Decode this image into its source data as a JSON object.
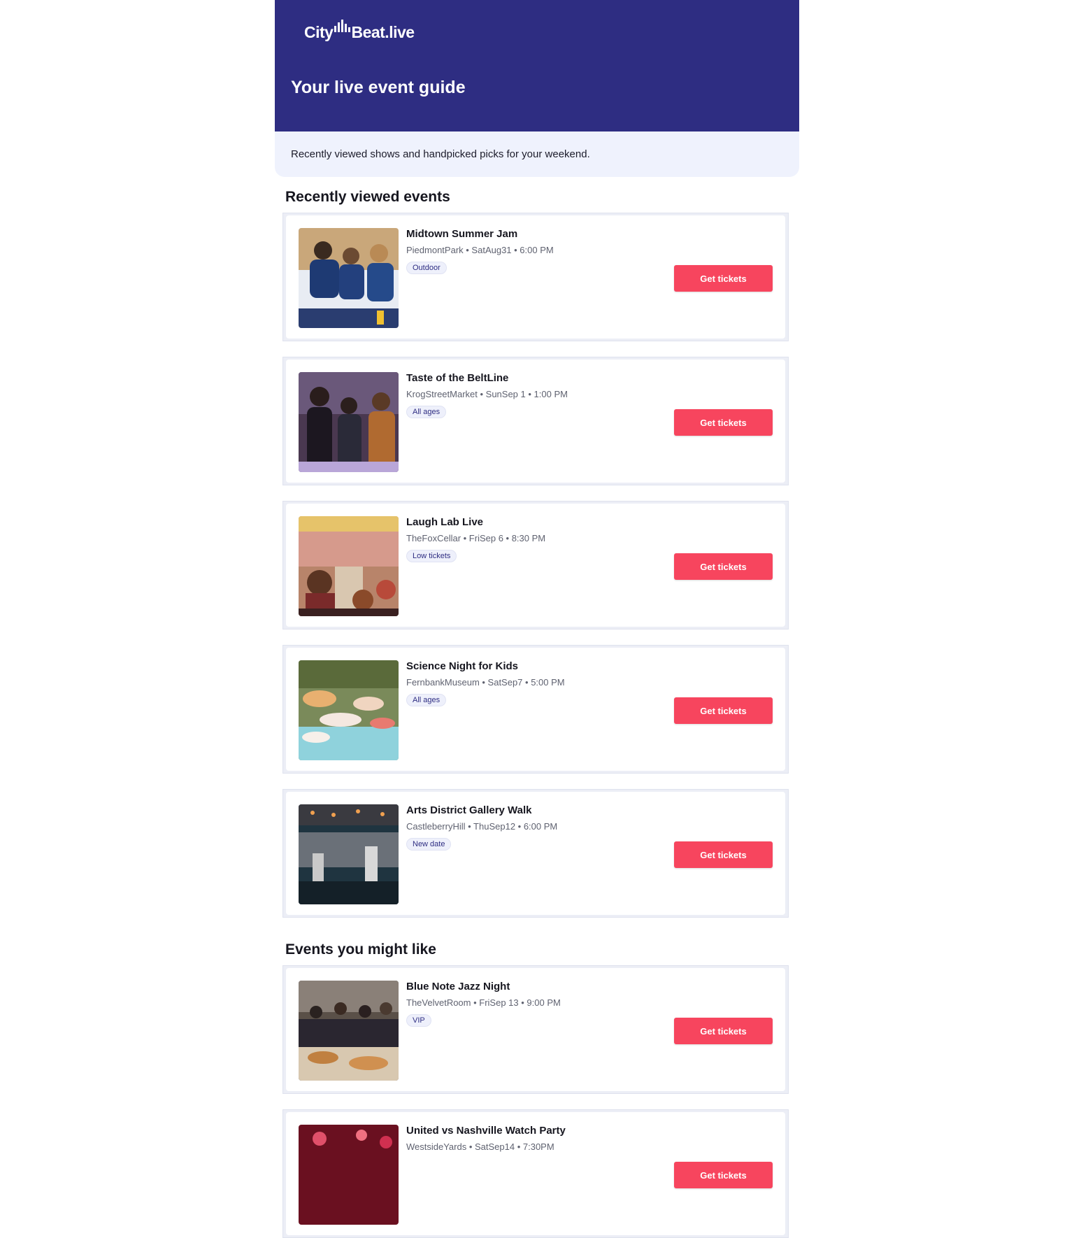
{
  "brand": {
    "logo_left": "City",
    "logo_right": "Beat.live"
  },
  "header": {
    "headline": "Your live event guide"
  },
  "intro": {
    "text": "Recently viewed shows and handpicked picks for your weekend."
  },
  "sections": [
    {
      "title": "Recently viewed events",
      "events": [
        {
          "title": "Midtown Summer Jam",
          "meta": "PiedmontPark • SatAug31 • 6:00 PM",
          "tag": "Outdoor",
          "cta": "Get tickets"
        },
        {
          "title": "Taste of the BeltLine",
          "meta": "KrogStreetMarket • SunSep 1 • 1:00 PM",
          "tag": "All ages",
          "cta": "Get tickets"
        },
        {
          "title": "Laugh Lab Live",
          "meta": "TheFoxCellar • FriSep 6 • 8:30 PM",
          "tag": "Low tickets",
          "cta": "Get tickets"
        },
        {
          "title": "Science Night for Kids",
          "meta": "FernbankMuseum • SatSep7 • 5:00 PM",
          "tag": "All ages",
          "cta": "Get tickets"
        },
        {
          "title": "Arts District Gallery Walk",
          "meta": "CastleberryHill • ThuSep12 • 6:00 PM",
          "tag": "New date",
          "cta": "Get tickets"
        }
      ]
    },
    {
      "title": "Events you might like",
      "events": [
        {
          "title": "Blue Note Jazz Night",
          "meta": "TheVelvetRoom • FriSep 13 • 9:00 PM",
          "tag": "VIP",
          "cta": "Get tickets"
        },
        {
          "title": "United vs Nashville Watch Party",
          "meta": "WestsideYards • SatSep14 • 7:30PM",
          "tag": "",
          "cta": "Get tickets"
        }
      ]
    }
  ],
  "colors": {
    "header_bg": "#2e2d82",
    "intro_bg": "#eff2fd",
    "cta_bg": "#f7455e",
    "tag_text": "#2e2d82"
  }
}
